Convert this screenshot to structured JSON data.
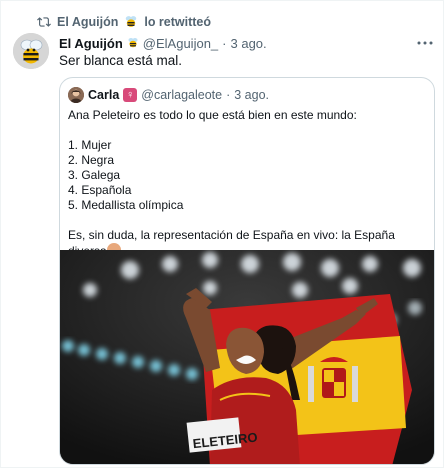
{
  "retweet": {
    "label": "El Aguijón",
    "suffix": "lo retwitteó"
  },
  "tweet": {
    "name": "El Aguijón",
    "handle": "@ElAguijon_",
    "dot": "·",
    "time": "3 ago.",
    "text": "Ser blanca está mal."
  },
  "quote": {
    "name": "Carla",
    "handle": "@carlagaleote",
    "dot": "·",
    "time": "3 ago.",
    "intro": "Ana Peleteiro es todo lo que está bien en este mundo:",
    "list": [
      "1. Mujer",
      "2. Negra",
      "3. Galega",
      "4. Española",
      "5. Medallista olímpica"
    ],
    "closing": "Es, sin duda, la representación de España en vivo: la España diversa",
    "bib_text": "ELETEIRO"
  },
  "icons": {
    "retweet": "retweet-icon",
    "more": "more-icon",
    "bee": "bee-icon",
    "venus": "venus-emoji",
    "clap": "clap-emoji"
  },
  "colors": {
    "secondary": "#536471",
    "border": "#cfd9de",
    "text": "#0f1419"
  }
}
